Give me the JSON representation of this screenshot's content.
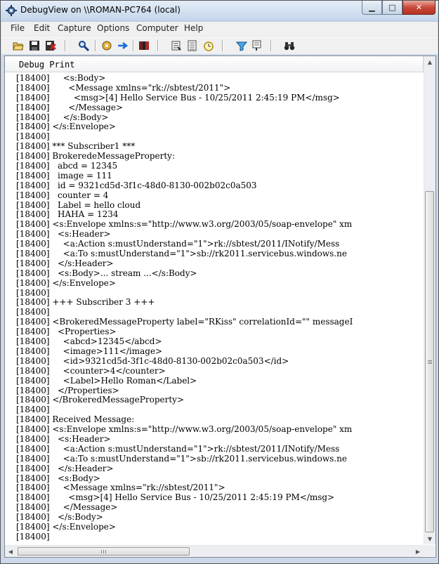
{
  "window": {
    "title": "DebugView on \\\\ROMAN-PC764 (local)"
  },
  "menu": [
    "File",
    "Edit",
    "Capture",
    "Options",
    "Computer",
    "Help"
  ],
  "toolbar_icons": [
    "open-icon",
    "save-icon",
    "clear-icon",
    "find-icon",
    "capture-icon",
    "autoscroll-icon",
    "history-icon",
    "options-icon",
    "time-icon",
    "clock-icon",
    "filter-icon",
    "highlight-icon",
    "binoculars-icon"
  ],
  "column_header": "Debug Print",
  "pid": "[18400]",
  "lines": [
    "    <s:Body>",
    "      <Message xmlns=\"rk://sbtest/2011\">",
    "        <msg>[4] Hello Service Bus - 10/25/2011 2:45:19 PM</msg>",
    "      </Message>",
    "    </s:Body>",
    "</s:Envelope>",
    "",
    "*** Subscriber1 ***",
    "BrokeredeMessageProperty:",
    "  abcd = 12345",
    "  image = 111",
    "  id = 9321cd5d-3f1c-48d0-8130-002b02c0a503",
    "  counter = 4",
    "  Label = hello cloud",
    "  HAHA = 1234",
    "<s:Envelope xmlns:s=\"http://www.w3.org/2003/05/soap-envelope\" xm",
    "  <s:Header>",
    "    <a:Action s:mustUnderstand=\"1\">rk://sbtest/2011/INotify/Mess",
    "    <a:To s:mustUnderstand=\"1\">sb://rk2011.servicebus.windows.ne",
    "  </s:Header>",
    "  <s:Body>... stream ...</s:Body>",
    "</s:Envelope>",
    "",
    "+++ Subscriber 3 +++",
    "",
    "<BrokeredMessageProperty label=\"RKiss\" correlationId=\"\" messageI",
    "  <Properties>",
    "    <abcd>12345</abcd>",
    "    <image>111</image>",
    "    <id>9321cd5d-3f1c-48d0-8130-002b02c0a503</id>",
    "    <counter>4</counter>",
    "    <Label>Hello Roman</Label>",
    "  </Properties>",
    "</BrokeredMessageProperty>",
    "",
    "Received Message:",
    "<s:Envelope xmlns:s=\"http://www.w3.org/2003/05/soap-envelope\" xm",
    "  <s:Header>",
    "    <a:Action s:mustUnderstand=\"1\">rk://sbtest/2011/INotify/Mess",
    "    <a:To s:mustUnderstand=\"1\">sb://rk2011.servicebus.windows.ne",
    "  </s:Header>",
    "  <s:Body>",
    "    <Message xmlns=\"rk://sbtest/2011\">",
    "      <msg>[4] Hello Service Bus - 10/25/2011 2:45:19 PM</msg>",
    "    </Message>",
    "  </s:Body>",
    "</s:Envelope>",
    ""
  ]
}
